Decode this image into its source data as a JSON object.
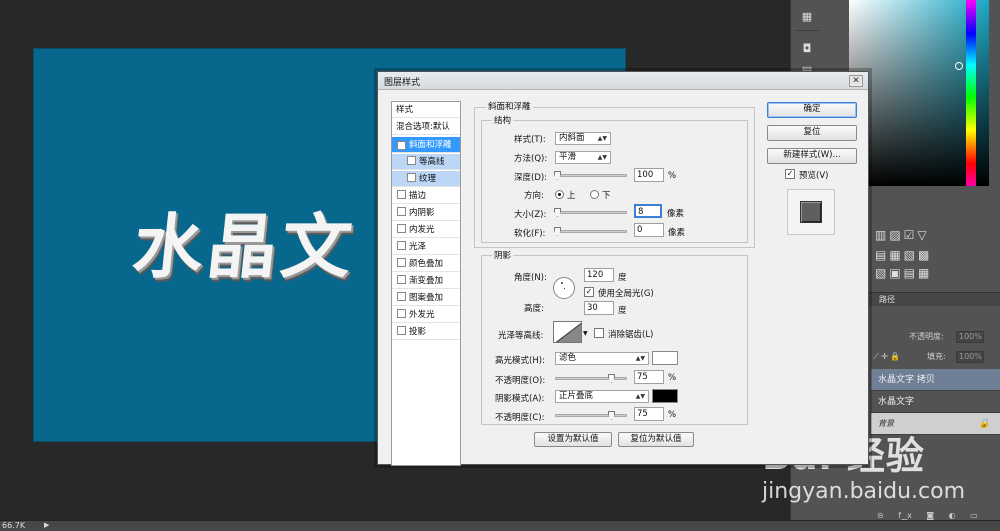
{
  "canvas": {
    "text": "水晶文",
    "bg_color": "#07678c",
    "zoom": "66.7K"
  },
  "right_panel": {
    "layers_tab": "路径",
    "opacity_label": "不透明度:",
    "opacity_value": "100%",
    "fill_label": "填充:",
    "fill_value": "100%",
    "layers": [
      {
        "name": "水晶文字 拷贝",
        "selected": true
      },
      {
        "name": "水晶文字",
        "selected": false
      },
      {
        "name": "背景",
        "locked": true
      }
    ]
  },
  "watermark": {
    "logo": "Bai  经验",
    "sub": "jingyan.baidu.com"
  },
  "dialog": {
    "title": "图层样式",
    "close": "✕",
    "style_list": {
      "header": "样式",
      "blend": "混合选项:默认",
      "items": [
        {
          "label": "斜面和浮雕",
          "checked": true,
          "selected": true
        },
        {
          "label": "等高线",
          "checked": false,
          "sub": true
        },
        {
          "label": "纹理",
          "checked": false,
          "sub": true
        },
        {
          "label": "描边",
          "checked": false
        },
        {
          "label": "内阴影",
          "checked": false
        },
        {
          "label": "内发光",
          "checked": false
        },
        {
          "label": "光泽",
          "checked": false
        },
        {
          "label": "颜色叠加",
          "checked": false
        },
        {
          "label": "渐变叠加",
          "checked": false
        },
        {
          "label": "图案叠加",
          "checked": false
        },
        {
          "label": "外发光",
          "checked": false
        },
        {
          "label": "投影",
          "checked": false
        }
      ]
    },
    "bevel": {
      "section_title": "斜面和浮雕",
      "structure_title": "结构",
      "style_label": "样式(T):",
      "style_value": "内斜面",
      "technique_label": "方法(Q):",
      "technique_value": "平滑",
      "depth_label": "深度(D):",
      "depth_value": "100",
      "depth_unit": "%",
      "direction_label": "方向:",
      "dir_up": "上",
      "dir_down": "下",
      "size_label": "大小(Z):",
      "size_value": "8",
      "size_unit": "像素",
      "soften_label": "软化(F):",
      "soften_value": "0",
      "soften_unit": "像素"
    },
    "shading": {
      "title": "阴影",
      "angle_label": "角度(N):",
      "angle_value": "120",
      "angle_unit": "度",
      "global_light": "使用全局光(G)",
      "altitude_label": "高度:",
      "altitude_value": "30",
      "altitude_unit": "度",
      "gloss_label": "光泽等高线:",
      "anti_alias": "消除锯齿(L)",
      "highlight_label": "高光模式(H):",
      "highlight_mode": "滤色",
      "highlight_color": "#ffffff",
      "hl_opacity_label": "不透明度(O):",
      "hl_opacity_value": "75",
      "hl_opacity_unit": "%",
      "shadow_label": "阴影模式(A):",
      "shadow_mode": "正片叠底",
      "shadow_color": "#000000",
      "sh_opacity_label": "不透明度(C):",
      "sh_opacity_value": "75",
      "sh_opacity_unit": "%"
    },
    "buttons": {
      "ok": "确定",
      "reset": "复位",
      "new_style": "新建样式(W)...",
      "preview": "预览(V)",
      "make_default": "设置为默认值",
      "reset_default": "复位为默认值"
    }
  }
}
